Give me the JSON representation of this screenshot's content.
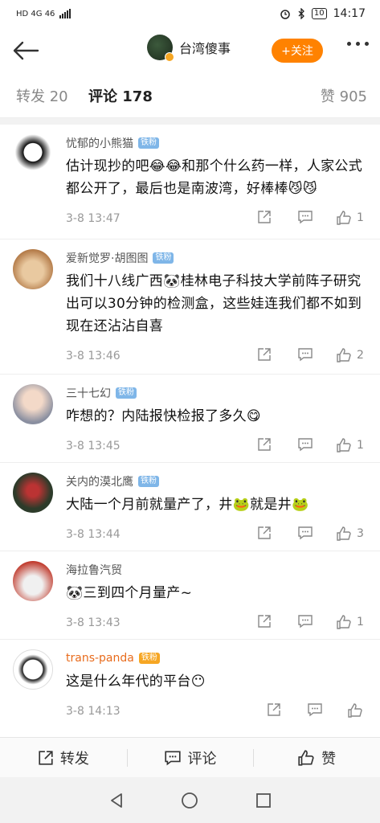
{
  "status_bar": {
    "left": "HD 4G 46",
    "right_battery": "10",
    "time": "14:17"
  },
  "nav": {
    "title": "台湾傻事",
    "follow_label": "+关注"
  },
  "tabs": {
    "repost": "转发 20",
    "comment": "评论 178",
    "like": "赞 905"
  },
  "comments": [
    {
      "name": "忧郁的小熊猫",
      "badge": "铁粉",
      "text": "估计现抄的吧😂😂和那个什么药一样，人家公式都公开了，最后也是南波湾，好棒棒😼😼",
      "time": "3-8 13:47",
      "likes": "1"
    },
    {
      "name": "爱新觉罗·胡图图",
      "badge": "铁粉",
      "text": "我们十八线广西🐼桂林电子科技大学前阵子研究出可以30分钟的检测盒，这些娃连我们都不如到现在还沾沾自喜",
      "time": "3-8 13:46",
      "likes": "2"
    },
    {
      "name": "三十七幻",
      "badge": "铁粉",
      "text": "咋想的？内陆报快检报了多久😋",
      "time": "3-8 13:45",
      "likes": "1"
    },
    {
      "name": "关内的漠北鹰",
      "badge": "铁粉",
      "text": "大陆一个月前就量产了，井🐸就是井🐸",
      "time": "3-8 13:44",
      "likes": "3"
    },
    {
      "name": "海拉鲁汽贸",
      "badge": "",
      "text": "🐼三到四个月量产~",
      "time": "3-8 13:43",
      "likes": "1"
    },
    {
      "name": "trans-panda",
      "badge": "铁粉",
      "text": "这是什么年代的平台😶",
      "time": "3-8 14:13",
      "likes": ""
    }
  ],
  "bottom_bar": {
    "repost": "转发",
    "comment": "评论",
    "like": "赞"
  }
}
